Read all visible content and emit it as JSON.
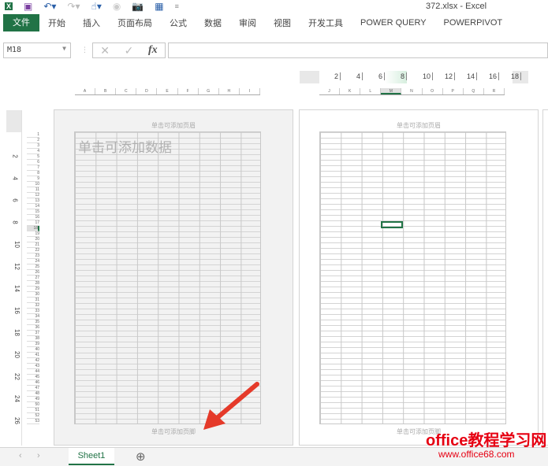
{
  "window": {
    "title": "372.xlsx - Excel"
  },
  "quick_access": [
    "excel-logo-icon",
    "save-icon",
    "undo-icon",
    "redo-icon",
    "touch-mode-icon",
    "record-icon",
    "camera-icon",
    "form-icon",
    "customize-icon"
  ],
  "ribbon": {
    "tabs": [
      "文件",
      "开始",
      "插入",
      "页面布局",
      "公式",
      "数据",
      "审阅",
      "视图",
      "开发工具",
      "POWER QUERY",
      "POWERPIVOT"
    ]
  },
  "formula_bar": {
    "name_box": "M18",
    "cancel": "✕",
    "enter": "✓",
    "fx": "fx",
    "value": ""
  },
  "ruler": {
    "top_labels": [
      "2",
      "4",
      "6",
      "8",
      "10",
      "12",
      "14",
      "16",
      "18"
    ],
    "left_labels": [
      "2",
      "4",
      "6",
      "8",
      "10",
      "12",
      "14",
      "16",
      "18",
      "20",
      "22",
      "24",
      "26"
    ]
  },
  "pages": [
    {
      "columns": [
        "A",
        "B",
        "C",
        "D",
        "E",
        "F",
        "G",
        "H",
        "I"
      ],
      "header": "单击可添加页眉",
      "footer": "单击可添加页脚",
      "data_prompt": "单击可添加数据"
    },
    {
      "columns": [
        "J",
        "K",
        "L",
        "M",
        "N",
        "O",
        "P",
        "Q",
        "R"
      ],
      "header": "单击可添加页眉",
      "footer": "单击可添加页脚",
      "selected_column": "M",
      "selected_cell": "M18"
    }
  ],
  "row_count": 53,
  "sheets": {
    "tabs": [
      "Sheet1"
    ],
    "add": "⊕",
    "nav_prev": "‹",
    "nav_next": "›"
  },
  "watermark": {
    "line1": "office教程学习网",
    "line2": "www.office68.com"
  },
  "colors": {
    "accent": "#217346",
    "annotation": "#e53a2a",
    "watermark": "#e60012"
  }
}
